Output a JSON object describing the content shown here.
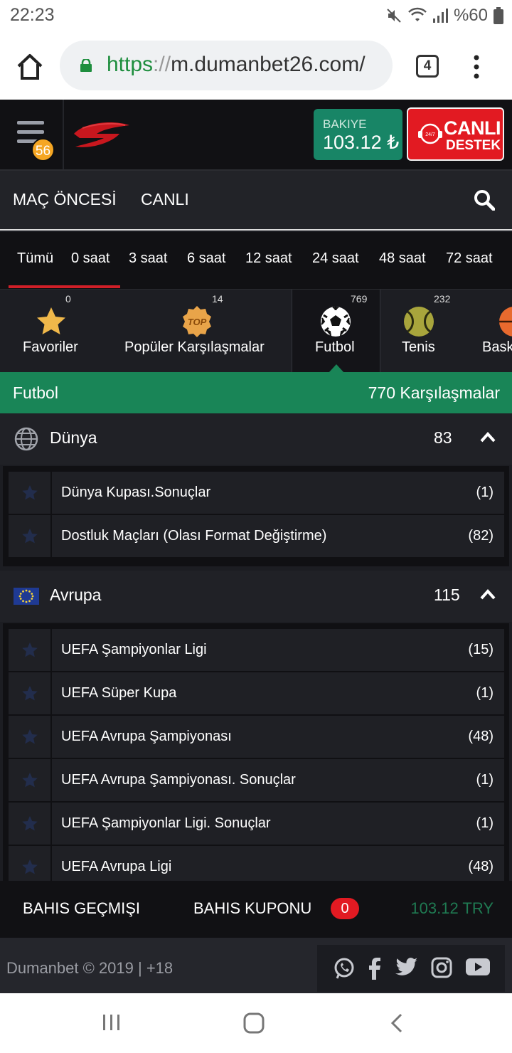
{
  "status_bar": {
    "time": "22:23",
    "battery": "%60"
  },
  "browser": {
    "url_scheme": "https",
    "url_sep": "://",
    "url_host": "m.dumanbet26.com/",
    "tab_count": "4"
  },
  "header": {
    "menu_badge": "56",
    "balance_label": "BAKIYE",
    "balance_value": "103.12 ₺",
    "support_line1": "CANLI",
    "support_line2": "DESTEK",
    "support_icon_text": "24/7"
  },
  "nav": {
    "pre_match": "MAÇ ÖNCESİ",
    "live": "CANLI"
  },
  "time_filters": [
    "Tümü",
    "0 saat",
    "3 saat",
    "6 saat",
    "12 saat",
    "24 saat",
    "48 saat",
    "72 saat"
  ],
  "sports": [
    {
      "label": "Favoriler",
      "count": "0",
      "icon": "star-icon"
    },
    {
      "label": "Popüler Karşılaşmalar",
      "count": "14",
      "icon": "top-badge-icon",
      "badge_text": "TOP"
    },
    {
      "label": "Futbol",
      "count": "769",
      "icon": "soccer-ball-icon"
    },
    {
      "label": "Tenis",
      "count": "232",
      "icon": "tennis-ball-icon"
    },
    {
      "label": "Bask",
      "count": "",
      "icon": "basketball-icon"
    }
  ],
  "sport_header": {
    "name": "Futbol",
    "matches": "770 Karşılaşmalar"
  },
  "regions": [
    {
      "name": "Dünya",
      "count": "83",
      "flag": "globe-icon",
      "leagues": [
        {
          "name": "Dünya Kupası.Sonuçlar",
          "count": "(1)"
        },
        {
          "name": "Dostluk Maçları (Olası Format Değiştirme)",
          "count": "(82)"
        }
      ]
    },
    {
      "name": "Avrupa",
      "count": "115",
      "flag": "eu-flag-icon",
      "leagues": [
        {
          "name": "UEFA Şampiyonlar Ligi",
          "count": "(15)"
        },
        {
          "name": "UEFA Süper Kupa",
          "count": "(1)"
        },
        {
          "name": "UEFA Avrupa Şampiyonası",
          "count": "(48)"
        },
        {
          "name": "UEFA Avrupa Şampiyonası. Sonuçlar",
          "count": "(1)"
        },
        {
          "name": "UEFA Şampiyonlar Ligi. Sonuçlar",
          "count": "(1)"
        },
        {
          "name": "UEFA Avrupa Ligi",
          "count": "(48)"
        }
      ]
    }
  ],
  "bet_bar": {
    "history": "BAHIS GEÇMIŞI",
    "coupon": "BAHIS KUPONU",
    "coupon_count": "0",
    "amount": "103.12 TRY"
  },
  "footer": {
    "copyright": "Dumanbet © 2019 | +18"
  },
  "colors": {
    "accent_green": "#198557",
    "accent_red": "#e21a22",
    "badge_orange": "#f5a623"
  }
}
